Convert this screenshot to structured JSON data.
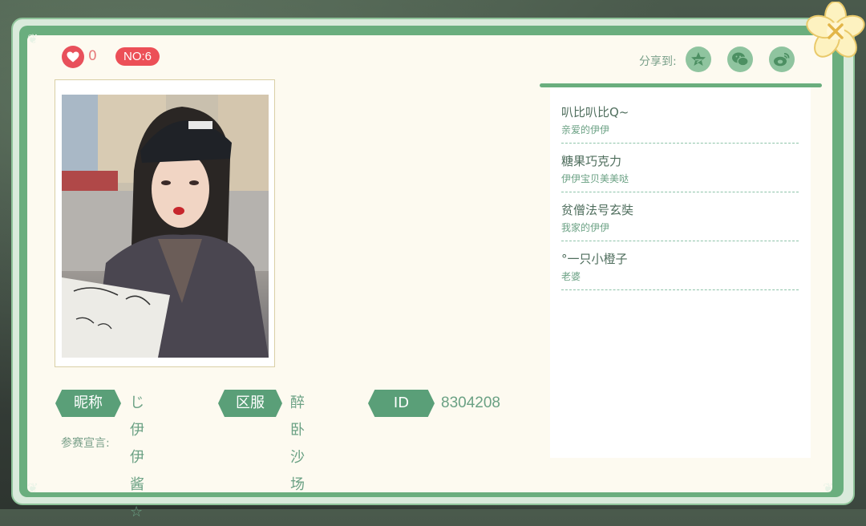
{
  "header": {
    "like_count": "0",
    "rank_badge": "NO:6",
    "share_label": "分享到:",
    "share_targets": [
      "qzone-icon",
      "wechat-icon",
      "weibo-icon"
    ]
  },
  "profile": {
    "nickname_label": "昵称",
    "nickname": "じ伊伊酱☆",
    "server_label": "区服",
    "server": "醉卧沙场",
    "id_label": "ID",
    "id": "8304208",
    "declaration_label": "参赛宣言:"
  },
  "supporters": [
    {
      "name": "叭比叭比Q~",
      "message": "亲爱的伊伊"
    },
    {
      "name": "糖果巧克力",
      "message": "伊伊宝贝美美哒"
    },
    {
      "name": "贫僧法号玄奘",
      "message": "我家的伊伊"
    },
    {
      "name": "°一只小橙子",
      "message": "老婆"
    }
  ],
  "colors": {
    "accent_green": "#5a9f78",
    "badge_red": "#ec4f57",
    "panel_bg": "#fdfaf0"
  }
}
